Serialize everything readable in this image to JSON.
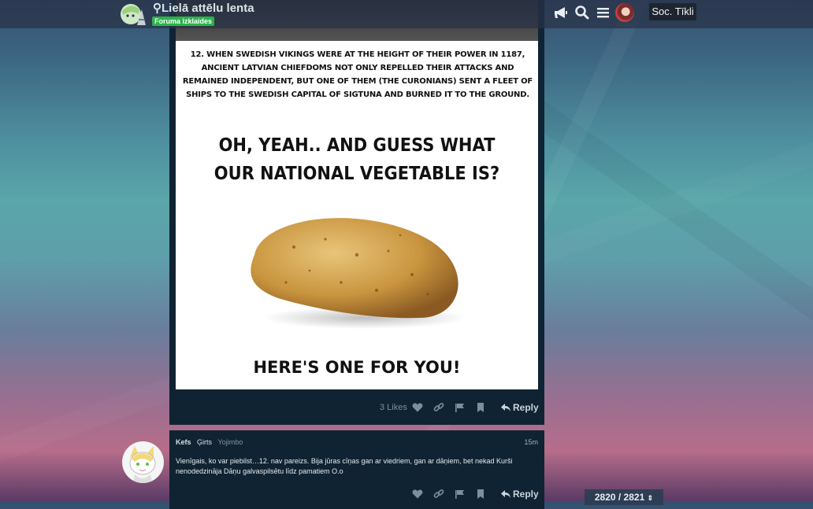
{
  "header": {
    "title": "Lielā attēlu lenta",
    "badge": "Foruma izklaides",
    "soc_button": "Soc. Tīkli",
    "icons": [
      "announce-icon",
      "search-icon",
      "menu-icon"
    ]
  },
  "post1": {
    "meme": {
      "text_fact": "12. When Swedish Vikings were at the height of their power in 1187, ancient Latvian chiefdoms not only repelled their attacks and remained independent, but one of them (the Curonians) sent a fleet of ships to the Swedish capital of Sigtuna and burned it to the ground.",
      "text_question_1": "OH, YEAH.. AND GUESS WHAT",
      "text_question_2": "OUR NATIONAL VEGETABLE IS?",
      "text_bottom": "HERE'S ONE FOR YOU!"
    },
    "likes": "3 Likes",
    "reply": "Reply"
  },
  "post2": {
    "author": "Kefs",
    "name2": "Ģirts",
    "title": "Yojimbo",
    "time": "15m",
    "text": "Vienīgais, ko var piebilst…12. nav pareizs. Bija jūras cīņas gan ar viedriem, gan ar dāņiem, bet nekad Kurši nenodedzināja Dāņu galvaspilsētu līdz pamatiem O.o",
    "reply": "Reply"
  },
  "pager": {
    "text": "2820 / 2821"
  },
  "colors": {
    "card_bg": "#102332",
    "badge_green": "#2bb34a"
  }
}
